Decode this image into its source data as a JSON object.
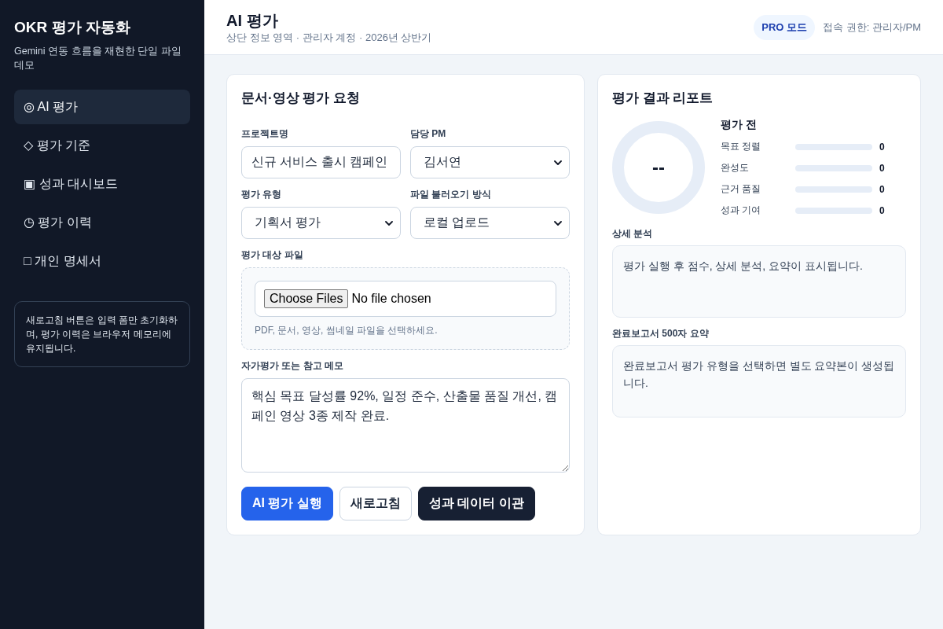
{
  "sidebar": {
    "title": "OKR 평가 자동화",
    "subtitle": "Gemini 연동 흐름을 재현한 단일 파일 데모",
    "items": [
      {
        "label": "◎ AI 평가",
        "selected": true
      },
      {
        "label": "◇ 평가 기준",
        "selected": false
      },
      {
        "label": "▣ 성과 대시보드",
        "selected": false
      },
      {
        "label": "◷ 평가 이력",
        "selected": false
      },
      {
        "label": "□ 개인 명세서",
        "selected": false
      }
    ],
    "note": "새로고침 버튼은 입력 폼만 초기화하며, 평가 이력은 브라우저 메모리에 유지됩니다."
  },
  "header": {
    "title": "AI 평가",
    "subtitle": "상단 정보 영역 · 관리자 계정 · 2026년 상반기",
    "badge": "PRO 모드",
    "access": "접속 권한: 관리자/PM"
  },
  "request_form": {
    "title": "문서·영상 평가 요청",
    "fields": [
      {
        "kind": "text",
        "label": "프로젝트명",
        "value": "신규 서비스 출시 캠페인"
      },
      {
        "kind": "select",
        "label": "담당 PM",
        "value": "김서연"
      },
      {
        "kind": "select",
        "label": "평가 유형",
        "value": "기획서 평가"
      },
      {
        "kind": "select",
        "label": "파일 불러오기 방식",
        "value": "로컬 업로드"
      },
      {
        "kind": "file",
        "label": "평가 대상 파일",
        "button": "Choose Files",
        "status": "No file chosen",
        "hint": "PDF, 문서, 영상, 썸네일 파일을 선택하세요."
      },
      {
        "kind": "textarea",
        "label": "자가평가 또는 참고 메모",
        "value": "핵심 목표 달성률 92%, 일정 준수, 산출물 품질 개선, 캠페인 영상 3종 제작 완료."
      }
    ],
    "buttons": [
      {
        "kind": "primary",
        "label": "AI 평가 실행"
      },
      {
        "kind": "secondary",
        "label": "새로고침"
      },
      {
        "kind": "dark",
        "label": "성과 데이터 이관"
      }
    ]
  },
  "report": {
    "title": "평가 결과 리포트",
    "score": {
      "value": "--"
    },
    "status": "평가 전",
    "metrics": [
      {
        "label": "목표 정렬",
        "value": "0"
      },
      {
        "label": "완성도",
        "value": "0"
      },
      {
        "label": "근거 품질",
        "value": "0"
      },
      {
        "label": "성과 기여",
        "value": "0"
      }
    ],
    "sections": [
      {
        "label": "상세 분석",
        "text": "평가 실행 후 점수, 상세 분석, 요약이 표시됩니다."
      },
      {
        "label": "완료보고서 500자 요약",
        "text": "완료보고서 평가 유형을 선택하면 별도 요약본이 생성됩니다."
      }
    ]
  }
}
